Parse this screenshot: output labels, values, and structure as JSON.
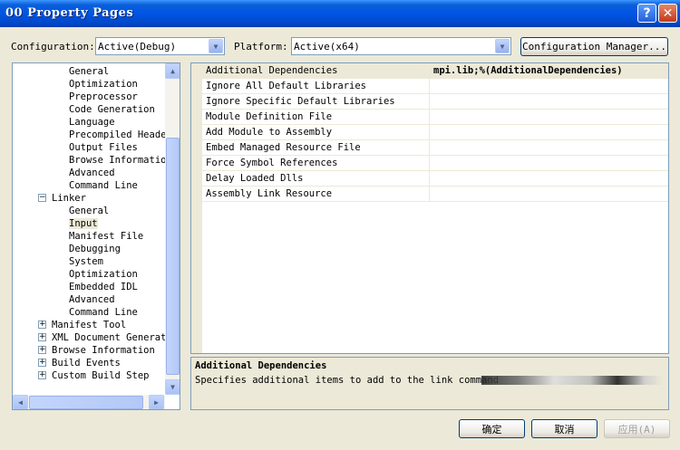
{
  "window": {
    "title": "00 Property Pages"
  },
  "toolbar": {
    "configuration_label": "Configuration:",
    "configuration_value": "Active(Debug)",
    "platform_label": "Platform:",
    "platform_value": "Active(x64)",
    "config_manager_label": "Configuration Manager..."
  },
  "tree": {
    "items": [
      {
        "label": "General"
      },
      {
        "label": "Optimization"
      },
      {
        "label": "Preprocessor"
      },
      {
        "label": "Code Generation"
      },
      {
        "label": "Language"
      },
      {
        "label": "Precompiled Heade"
      },
      {
        "label": "Output Files"
      },
      {
        "label": "Browse Informatio"
      },
      {
        "label": "Advanced"
      },
      {
        "label": "Command Line"
      },
      {
        "label": "Linker",
        "expander": "-"
      },
      {
        "label": "General"
      },
      {
        "label": "Input",
        "selected": true
      },
      {
        "label": "Manifest File"
      },
      {
        "label": "Debugging"
      },
      {
        "label": "System"
      },
      {
        "label": "Optimization"
      },
      {
        "label": "Embedded IDL"
      },
      {
        "label": "Advanced"
      },
      {
        "label": "Command Line"
      },
      {
        "label": "Manifest Tool",
        "expander": "+"
      },
      {
        "label": "XML Document Generato",
        "expander": "+"
      },
      {
        "label": "Browse Information",
        "expander": "+"
      },
      {
        "label": "Build Events",
        "expander": "+"
      },
      {
        "label": "Custom Build Step",
        "expander": "+"
      }
    ]
  },
  "properties": [
    {
      "name": "Additional Dependencies",
      "value": "mpi.lib;%(AdditionalDependencies)"
    },
    {
      "name": "Ignore All Default Libraries",
      "value": ""
    },
    {
      "name": "Ignore Specific Default Libraries",
      "value": ""
    },
    {
      "name": "Module Definition File",
      "value": ""
    },
    {
      "name": "Add Module to Assembly",
      "value": ""
    },
    {
      "name": "Embed Managed Resource File",
      "value": ""
    },
    {
      "name": "Force Symbol References",
      "value": ""
    },
    {
      "name": "Delay Loaded Dlls",
      "value": ""
    },
    {
      "name": "Assembly Link Resource",
      "value": ""
    }
  ],
  "description": {
    "title": "Additional Dependencies",
    "text": "Specifies additional items to add to the link command"
  },
  "buttons": {
    "ok": "确定",
    "cancel": "取消",
    "apply": "应用(A)"
  },
  "colors": {
    "title_bar": "#0055e5",
    "dialog_bg": "#ece9d8",
    "border": "#7f9db9"
  }
}
